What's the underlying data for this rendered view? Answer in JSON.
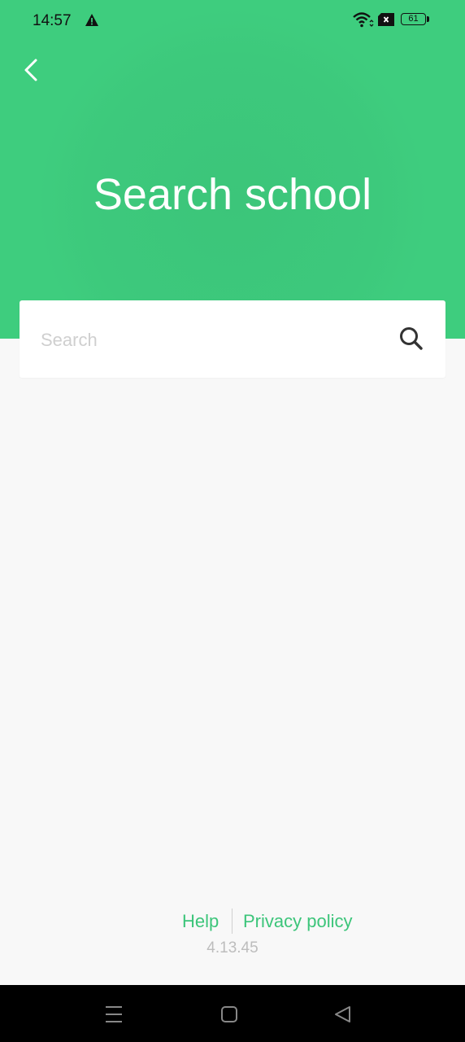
{
  "status_bar": {
    "time": "14:57",
    "alert_icon": "warning-triangle-icon",
    "wifi_icon": "wifi-icon",
    "sim_icon": "no-sim-icon",
    "battery_level": "61"
  },
  "header": {
    "back_icon": "chevron-left-icon",
    "title": "Search school",
    "color": "#3ecd7e"
  },
  "search": {
    "placeholder": "Search",
    "value": "",
    "icon": "search-icon"
  },
  "footer": {
    "help_label": "Help",
    "privacy_label": "Privacy policy",
    "version": "4.13.45",
    "link_color": "#3cc57a"
  },
  "nav_bar": {
    "menu_icon": "recent-apps-icon",
    "home_icon": "home-icon",
    "back_icon": "back-triangle-icon"
  }
}
